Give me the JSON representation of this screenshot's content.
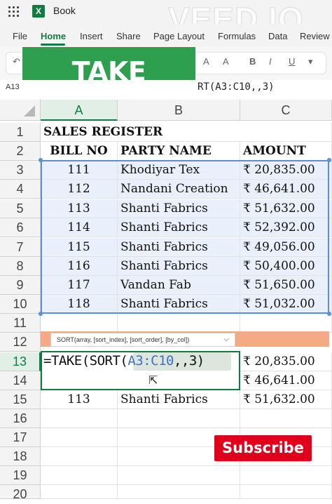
{
  "app": {
    "book_title": "Book",
    "watermark": "VEED.IO"
  },
  "ribbon": {
    "tabs": [
      "File",
      "Home",
      "Insert",
      "Share",
      "Page Layout",
      "Formulas",
      "Data",
      "Review"
    ],
    "active_tab": "Home"
  },
  "banner": {
    "text": "TAKE Function"
  },
  "formula_bar": {
    "name_box": "A13",
    "formula": "RT(A3:C10,,3)"
  },
  "grid": {
    "columns": [
      "A",
      "B",
      "C"
    ],
    "rows": [
      "1",
      "2",
      "3",
      "4",
      "5",
      "6",
      "7",
      "8",
      "9",
      "10",
      "11",
      "12",
      "13",
      "14",
      "15",
      "16",
      "17",
      "18",
      "19",
      "20"
    ],
    "title": "SALES REGISTER",
    "headers": [
      "BILL NO",
      "PARTY NAME",
      "AMOUNT"
    ],
    "data": [
      [
        "111",
        "Khodiyar Tex",
        "₹ 20,835.00"
      ],
      [
        "112",
        "Nandani Creation",
        "₹ 46,641.00"
      ],
      [
        "113",
        "Shanti Fabrics",
        "₹ 51,632.00"
      ],
      [
        "114",
        "Shanti Fabrics",
        "₹ 52,392.00"
      ],
      [
        "115",
        "Shanti Fabrics",
        "₹ 49,056.00"
      ],
      [
        "116",
        "Shanti Fabrics",
        "₹ 50,400.00"
      ],
      [
        "117",
        "Vandan Fab",
        "₹ 51,650.00"
      ],
      [
        "118",
        "Shanti Fabrics",
        "₹ 51,032.00"
      ]
    ],
    "result": [
      [
        "",
        "",
        "₹ 20,835.00"
      ],
      [
        "",
        "",
        "₹ 46,641.00"
      ],
      [
        "113",
        "Shanti Fabrics",
        "₹ 51,632.00"
      ]
    ]
  },
  "editor": {
    "prefix": "=TAKE(SORT(",
    "ref": "A3:C10",
    "suffix": ",,3)",
    "tooltip": "SORT(array, [sort_index], [sort_order], [by_col])"
  },
  "subscribe": {
    "label": "Subscribe"
  },
  "colors": {
    "excel_green": "#107c41",
    "banner_green": "#2e9e4f",
    "subscribe_red": "#e0001b",
    "selection_blue": "#5b8fd6"
  }
}
